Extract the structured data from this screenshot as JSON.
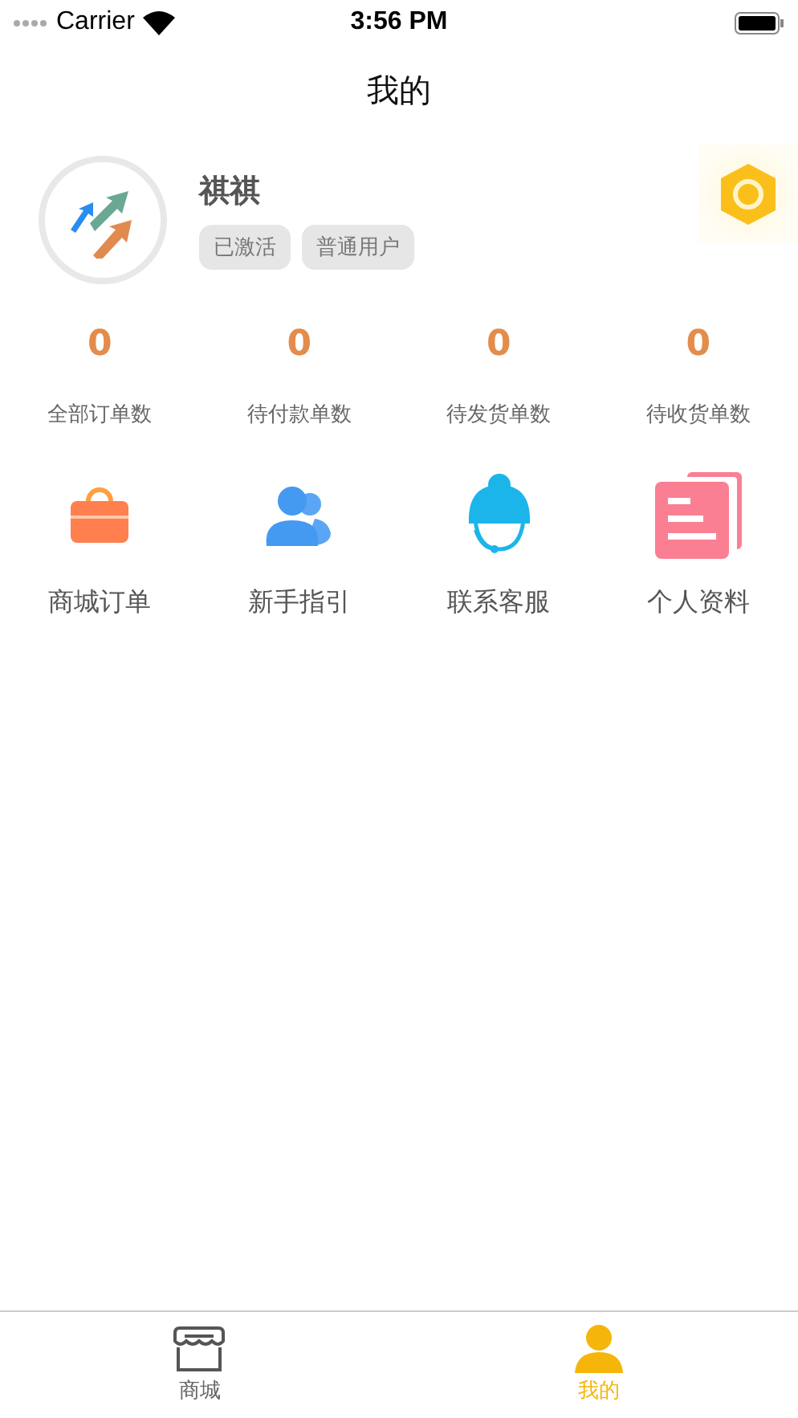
{
  "status_bar": {
    "carrier": "Carrier",
    "time": "3:56 PM"
  },
  "title": "我的",
  "profile": {
    "name": "祺祺",
    "tags": [
      "已激活",
      "普通用户"
    ]
  },
  "stats": [
    {
      "value": "0",
      "label": "全部订单数"
    },
    {
      "value": "0",
      "label": "待付款单数"
    },
    {
      "value": "0",
      "label": "待发货单数"
    },
    {
      "value": "0",
      "label": "待收货单数"
    }
  ],
  "menu": [
    {
      "kind": "bag",
      "label": "商城订单"
    },
    {
      "kind": "users",
      "label": "新手指引"
    },
    {
      "kind": "service",
      "label": "联系客服"
    },
    {
      "kind": "docs",
      "label": "个人资料"
    }
  ],
  "tab_bar": [
    {
      "kind": "shop",
      "label": "商城",
      "selected": false
    },
    {
      "kind": "me",
      "label": "我的",
      "selected": true
    }
  ]
}
